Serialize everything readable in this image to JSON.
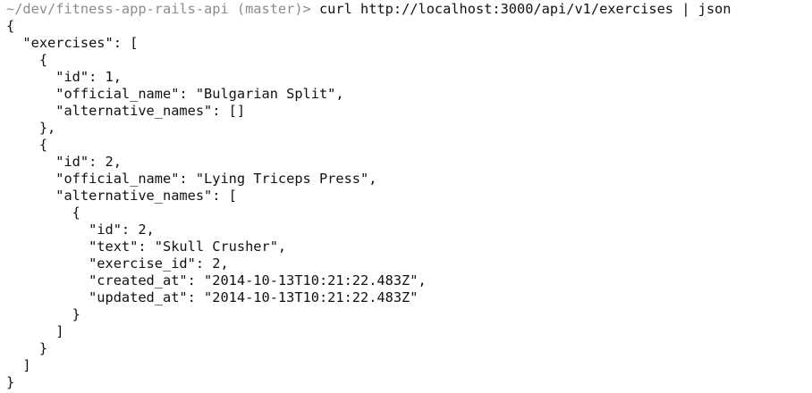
{
  "terminal": {
    "prompt": "~/dev/fitness-app-rails-api (master)>",
    "command": " curl http://localhost:3000/api/v1/exercises | json",
    "output_lines": [
      "{",
      "  \"exercises\": [",
      "    {",
      "      \"id\": 1,",
      "      \"official_name\": \"Bulgarian Split\",",
      "      \"alternative_names\": []",
      "    },",
      "    {",
      "      \"id\": 2,",
      "      \"official_name\": \"Lying Triceps Press\",",
      "      \"alternative_names\": [",
      "        {",
      "          \"id\": 2,",
      "          \"text\": \"Skull Crusher\",",
      "          \"exercise_id\": 2,",
      "          \"created_at\": \"2014-10-13T10:21:22.483Z\",",
      "          \"updated_at\": \"2014-10-13T10:21:22.483Z\"",
      "        }",
      "      ]",
      "    }",
      "  ]",
      "}"
    ]
  },
  "colors": {
    "prompt": "#8c8c8c",
    "text": "#111111",
    "background": "#ffffff"
  }
}
